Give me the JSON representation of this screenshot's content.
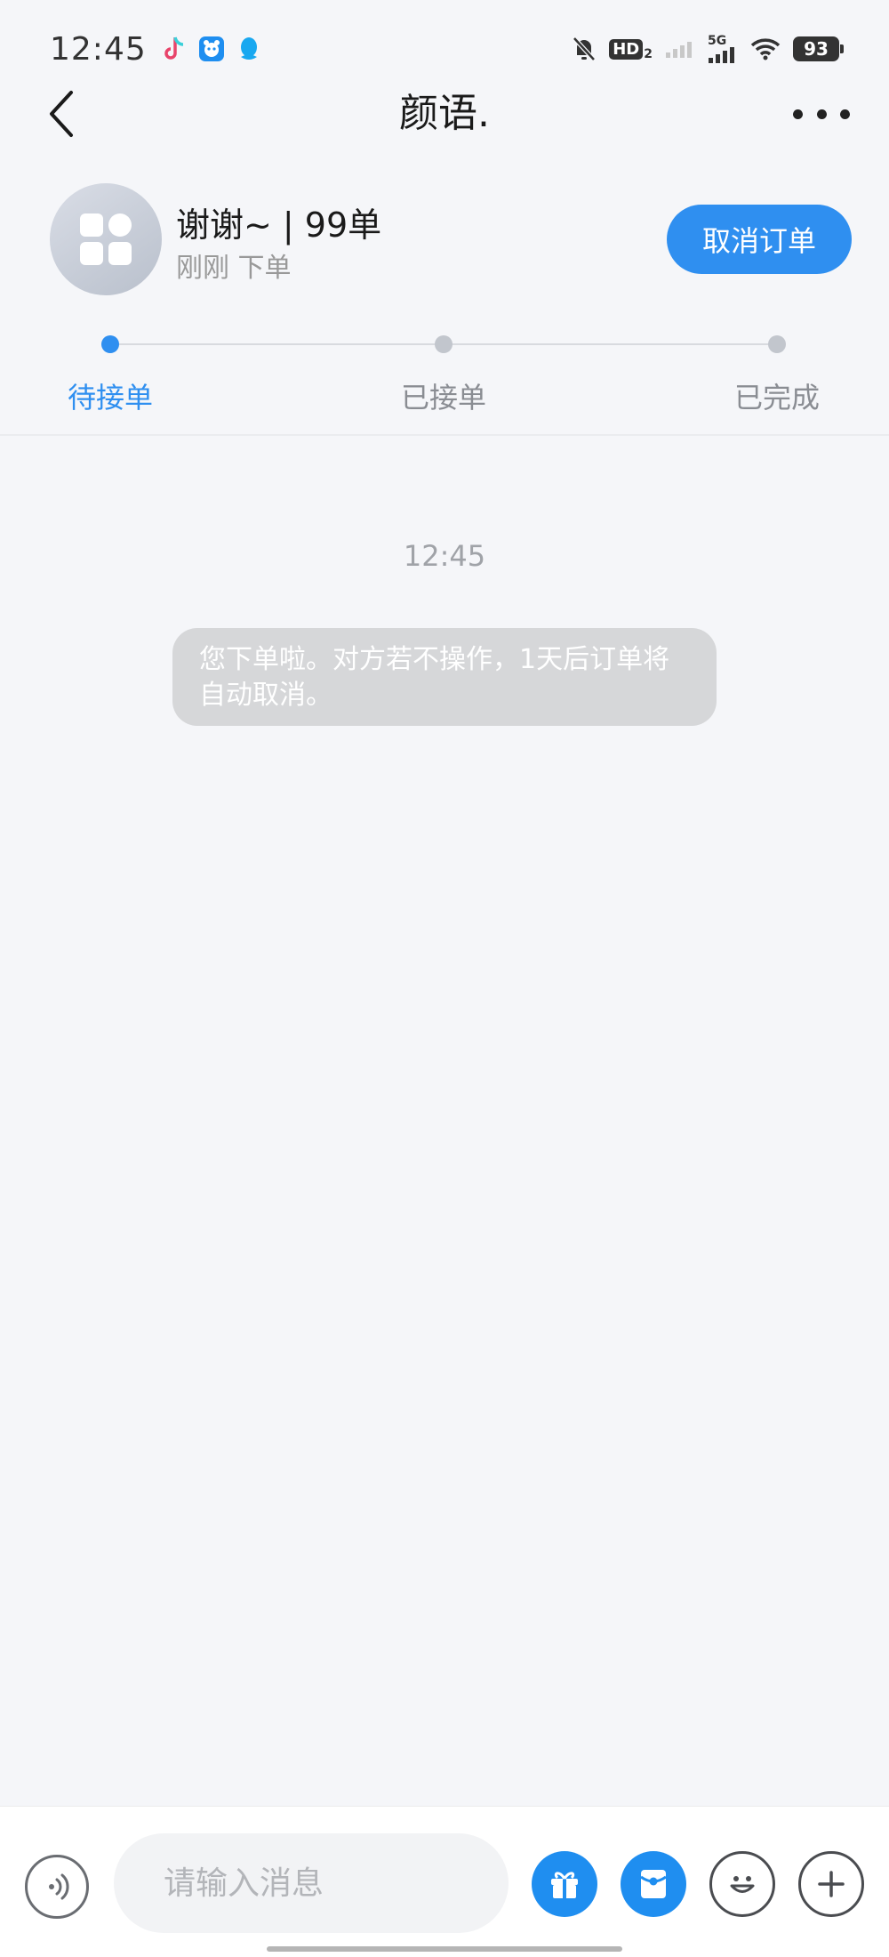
{
  "status_bar": {
    "time": "12:45",
    "hd_label": "HD",
    "hd_sub": "2",
    "network_label": "5G",
    "battery": "93",
    "left_icons": [
      "tiktok-icon",
      "app-bear-icon",
      "qq-icon"
    ],
    "right_icons": [
      "mute-bell-icon",
      "hd-icon",
      "signal-weak-icon",
      "signal-5g-icon",
      "wifi-icon",
      "battery-icon"
    ]
  },
  "nav": {
    "title": "颜语."
  },
  "order": {
    "title": "谢谢~ | 99单",
    "subtitle": "刚刚 下单",
    "cancel_label": "取消订单"
  },
  "progress": {
    "steps": [
      {
        "label": "待接单",
        "active": true
      },
      {
        "label": "已接单",
        "active": false
      },
      {
        "label": "已完成",
        "active": false
      }
    ]
  },
  "chat": {
    "time": "12:45",
    "system_message": "您下单啦。对方若不操作，1天后订单将自动取消。"
  },
  "input_bar": {
    "placeholder": "请输入消息",
    "buttons": [
      "voice-icon",
      "gift-icon",
      "red-packet-icon",
      "emoji-icon",
      "plus-icon"
    ]
  },
  "colors": {
    "accent": "#2f8ff0",
    "background": "#f5f6f9",
    "system_bubble": "#d6d7d9"
  }
}
